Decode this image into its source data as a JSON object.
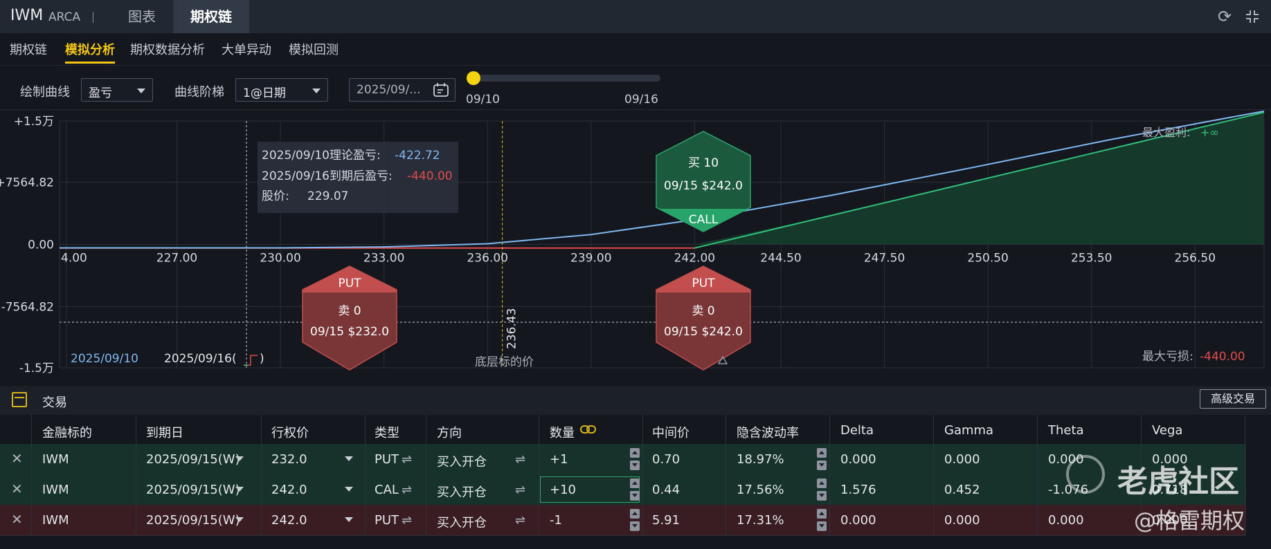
{
  "header": {
    "ticker": "IWM",
    "exchange": "ARCA",
    "tabs": [
      "图表",
      "期权链"
    ],
    "active_tab": "期权链",
    "icons": [
      "refresh-icon",
      "collapse-icon"
    ]
  },
  "subnav": {
    "items": [
      "期权链",
      "模拟分析",
      "期权数据分析",
      "大单异动",
      "模拟回测"
    ],
    "active": "模拟分析"
  },
  "controls": {
    "curve_label": "绘制曲线",
    "curve_value": "盈亏",
    "step_label": "曲线阶梯",
    "step_value": "1@日期",
    "date_value": "2025/09/...",
    "slider_start": "09/10",
    "slider_end": "09/16",
    "slider_position": 0
  },
  "chart": {
    "y_ticks": [
      "+1.5万",
      "+7564.82",
      "0.00",
      "-7564.82",
      "-1.5万"
    ],
    "x_ticks": [
      "4.00",
      "227.00",
      "230.00",
      "233.00",
      "236.00",
      "239.00",
      "242.00",
      "244.50",
      "247.50",
      "250.50",
      "253.50",
      "256.50"
    ],
    "tooltip": {
      "line1_label": "2025/09/10理论盈亏:",
      "line1_value": "-422.72",
      "line2_label": "2025/09/16到期后盈亏:",
      "line2_value": "-440.00",
      "line3_label": "股价:",
      "line3_value": "229.07"
    },
    "underlying_price": "236.43",
    "underlying_label": "底层标的价",
    "max_profit_label": "最大盈利:",
    "max_profit_value": "+∞",
    "max_loss_label": "最大亏损:",
    "max_loss_value": "-440.00",
    "legend": [
      "2025/09/10",
      "2025/09/16("
    ],
    "legend_close": ")",
    "markers": [
      {
        "type": "PUT",
        "action": "卖 0",
        "detail": "09/15 $232.0"
      },
      {
        "type": "CALL",
        "action": "买 10",
        "detail": "09/15 $242.0"
      },
      {
        "type": "PUT",
        "action": "卖 0",
        "detail": "09/15 $242.0"
      }
    ],
    "colors": {
      "theoretical": "#7fb8f0",
      "expiry": "#31c17a",
      "loss": "#e04b4b",
      "profit_fill": "#15392b"
    }
  },
  "chart_data": {
    "type": "line",
    "xlabel": "",
    "ylabel": "",
    "xlim": [
      223.6,
      258.5
    ],
    "ylim": [
      -15000,
      15000
    ],
    "series": [
      {
        "name": "2025/09/10",
        "x": [
          223.6,
          230,
          233,
          236,
          239,
          242,
          246,
          250,
          254,
          258.5
        ],
        "y": [
          -425,
          -423,
          -300,
          80,
          1200,
          3000,
          6000,
          9300,
          12700,
          16200
        ]
      },
      {
        "name": "2025/09/16",
        "x": [
          223.6,
          242,
          246,
          250,
          254,
          258.5
        ],
        "y": [
          -440,
          -440,
          3560,
          7560,
          11560,
          16060
        ]
      }
    ]
  },
  "trade": {
    "title": "交易",
    "advanced_button": "高级交易",
    "columns": [
      "金融标的",
      "到期日",
      "行权价",
      "类型",
      "方向",
      "数量",
      "中间价",
      "隐含波动率",
      "Delta",
      "Gamma",
      "Theta",
      "Vega"
    ],
    "rows": [
      {
        "symbol": "IWM",
        "expiry": "2025/09/15(W)",
        "strike": "232.0",
        "type": "PUT",
        "direction": "买入开仓",
        "qty": "+1",
        "mid": "0.70",
        "iv": "18.97%",
        "delta": "0.000",
        "gamma": "0.000",
        "theta": "0.000",
        "vega": "0.000"
      },
      {
        "symbol": "IWM",
        "expiry": "2025/09/15(W)",
        "strike": "242.0",
        "type": "CAL",
        "direction": "买入开仓",
        "qty": "+10",
        "mid": "0.44",
        "iv": "17.56%",
        "delta": "1.576",
        "gamma": "0.452",
        "theta": "-1.076",
        "vega": "0.718"
      },
      {
        "symbol": "IWM",
        "expiry": "2025/09/15(W)",
        "strike": "242.0",
        "type": "PUT",
        "direction": "买入开仓",
        "qty": "-1",
        "mid": "5.91",
        "iv": "17.31%",
        "delta": "0.000",
        "gamma": "0.000",
        "theta": "0.000",
        "vega": "0.000"
      }
    ]
  },
  "watermark": {
    "line1": "老虎社区",
    "line2": "@格雷期权"
  }
}
